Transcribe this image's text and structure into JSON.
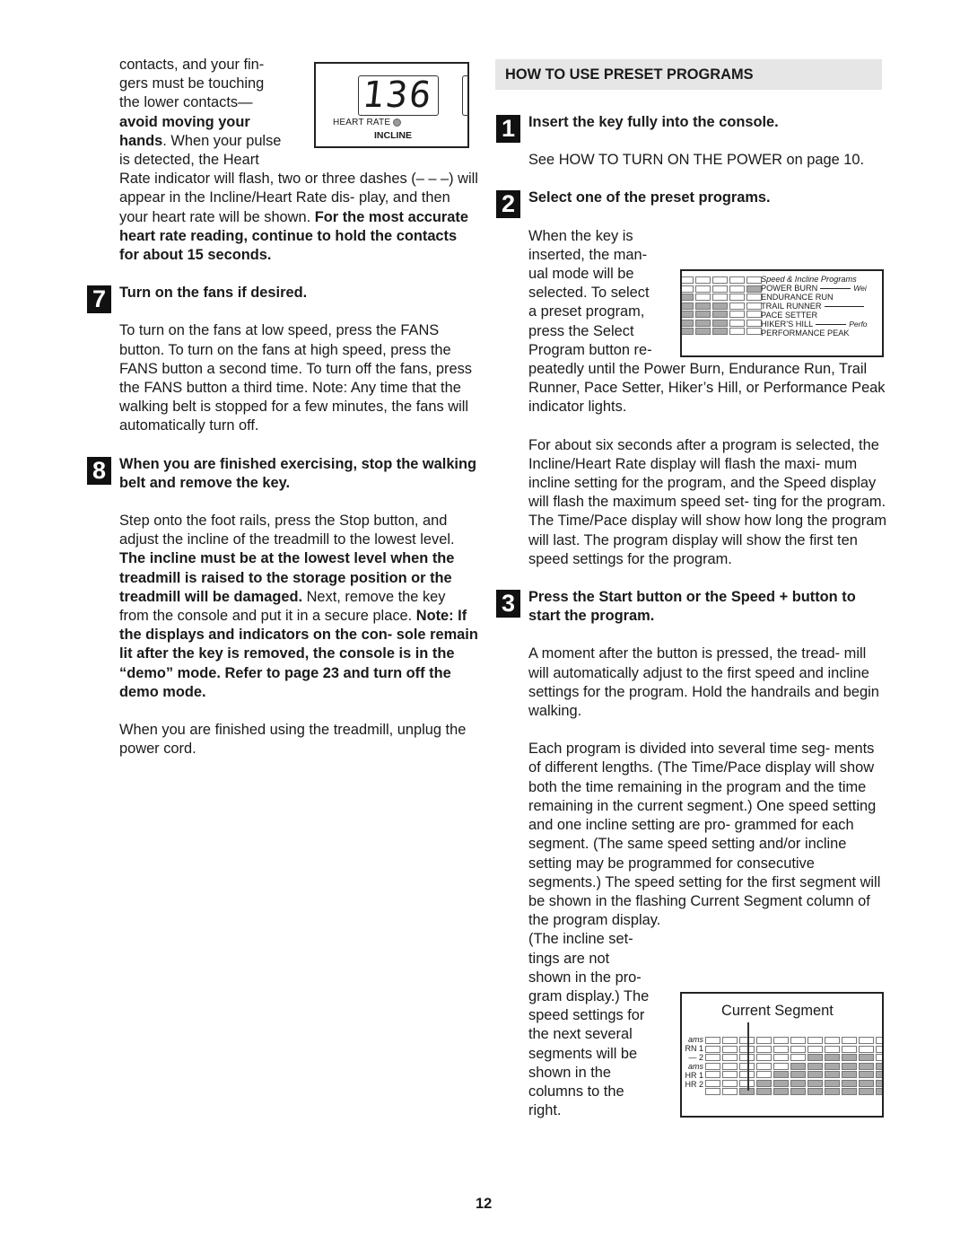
{
  "page_number": "12",
  "left_column": {
    "intro_lines": [
      "contacts, and your fin-",
      "gers must be touching",
      "the lower contacts—"
    ],
    "intro_bold": "avoid moving your",
    "intro_bold2": "hands",
    "intro_after_bold": ". When your pulse",
    "intro_line6": "is detected, the Heart",
    "intro_rest": "Rate indicator will flash, two or three dashes (– – –) will appear in the Incline/Heart Rate dis- play, and then your heart rate will be shown.",
    "intro_bold_tail_1": "For",
    "intro_bold_tail_2": "the most accurate heart rate reading, continue to hold the contacts for about 15 seconds.",
    "display_figure": {
      "readout": "136",
      "heart_rate_label": "HEART RATE",
      "incline_label": "INCLINE"
    },
    "step7": {
      "number": "7",
      "heading": "Turn on the fans if desired.",
      "body": "To turn on the fans at low speed, press the FANS button. To turn on the fans at high speed, press the FANS button a second time. To turn off the fans, press the FANS button a third time. Note: Any time that the walking belt is stopped for a few minutes, the fans will automatically turn off."
    },
    "step8": {
      "number": "8",
      "heading": "When you are finished exercising, stop the walking belt and remove the key.",
      "body_1": "Step onto the foot rails, press the Stop button, and adjust the incline of the treadmill to the lowest level.",
      "body_bold_1": "The incline must be at the lowest level when the treadmill is raised to the storage position or the treadmill will be damaged.",
      "body_2": "Next, remove the key from the console and put it in a secure place.",
      "body_bold_2": "Note: If the displays and indicators on the con- sole remain lit after the key is removed, the console is in the “demo” mode. Refer to page 23 and turn off the demo mode.",
      "body_3": "When you are finished using the treadmill, unplug the power cord."
    }
  },
  "right_column": {
    "section_title": "HOW TO USE PRESET PROGRAMS",
    "step1": {
      "number": "1",
      "heading": "Insert the key fully into the console.",
      "body": "See HOW TO TURN ON THE POWER on page 10."
    },
    "step2": {
      "number": "2",
      "heading": "Select one of the preset programs.",
      "body_wrapped": [
        "When the key is",
        "inserted, the man-",
        "ual mode will be",
        "selected. To select",
        "a preset program,",
        "press the Select",
        "Program button re-"
      ],
      "body_rest": "peatedly until the Power Burn, Endurance Run, Trail Runner, Pace Setter, Hiker’s Hill, or Performance Peak indicator lights.",
      "body_2": "For about six seconds after a program is selected, the Incline/Heart Rate display will flash the maxi- mum incline setting for the program, and the Speed display will flash the maximum speed set- ting for the program. The Time/Pace display will show how long the program will last. The program display will show the first ten speed settings for the program."
    },
    "programs_figure": {
      "title": "Speed & Incline Programs",
      "programs": [
        {
          "name": "POWER BURN",
          "side": "Wei"
        },
        {
          "name": "ENDURANCE RUN",
          "side": ""
        },
        {
          "name": "TRAIL RUNNER",
          "side": ""
        },
        {
          "name": "PACE SETTER",
          "side": ""
        },
        {
          "name": "HIKER’S HILL",
          "side": "Perfo"
        },
        {
          "name": "PERFORMANCE PEAK",
          "side": ""
        }
      ],
      "grid_lit": [
        [
          0,
          0,
          0,
          0,
          0
        ],
        [
          0,
          0,
          0,
          0,
          1
        ],
        [
          1,
          0,
          0,
          0,
          0
        ],
        [
          1,
          1,
          1,
          0,
          0
        ],
        [
          1,
          1,
          1,
          0,
          0
        ],
        [
          1,
          1,
          1,
          0,
          0
        ],
        [
          1,
          1,
          1,
          0,
          0
        ]
      ]
    },
    "step3": {
      "number": "3",
      "heading": "Press the Start button or the Speed + button to start the program.",
      "body_1": "A moment after the button is pressed, the tread- mill will automatically adjust to the first speed and incline settings for the program. Hold the handrails and begin walking.",
      "body_2": "Each program is divided into several time seg- ments of different lengths. (The Time/Pace display will show both the time remaining in the program and the time remaining in the current segment.) One speed setting and one incline setting are pro- grammed for each segment. (The same speed setting and/or incline setting may be programmed for consecutive segments.) The speed setting for the first segment will be shown in the flashing Current Segment column of the program display.",
      "body_wrapped": [
        "(The incline set-",
        "tings are not",
        "shown in the pro-",
        "gram display.) The",
        "speed settings for",
        "the next several",
        "segments will be",
        "shown in the",
        "columns to the",
        "right."
      ]
    },
    "segment_figure": {
      "title": "Current Segment",
      "side_labels": [
        "ams",
        "RN 1",
        "— 2",
        "ams",
        "HR 1",
        "HR 2"
      ],
      "grid_lit": [
        [
          0,
          0,
          0,
          0,
          0,
          0,
          0,
          0,
          0,
          0,
          0
        ],
        [
          0,
          0,
          0,
          0,
          0,
          0,
          0,
          0,
          0,
          0,
          0
        ],
        [
          0,
          0,
          0,
          0,
          0,
          0,
          1,
          1,
          1,
          1,
          0
        ],
        [
          0,
          0,
          0,
          0,
          0,
          1,
          1,
          1,
          1,
          1,
          1
        ],
        [
          0,
          0,
          0,
          0,
          1,
          1,
          1,
          1,
          1,
          1,
          1
        ],
        [
          0,
          0,
          0,
          1,
          1,
          1,
          1,
          1,
          1,
          1,
          1
        ],
        [
          0,
          0,
          1,
          1,
          1,
          1,
          1,
          1,
          1,
          1,
          1
        ]
      ]
    }
  }
}
